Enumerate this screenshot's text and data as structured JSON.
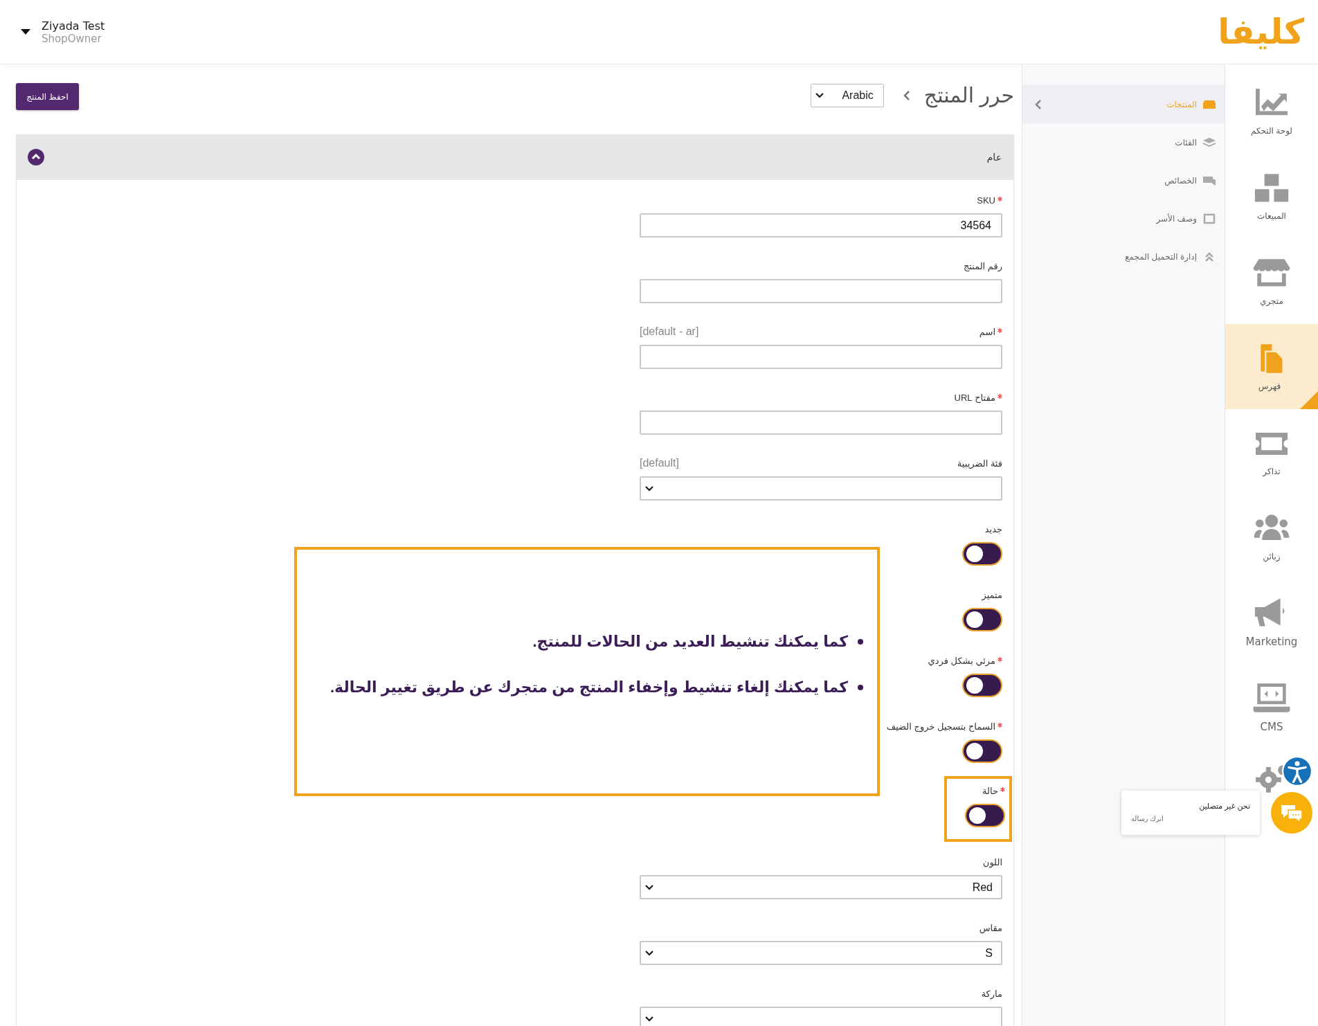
{
  "header": {
    "logo": "كليفا",
    "user_name": "Ziyada Test",
    "user_role": "ShopOwner"
  },
  "main_nav": [
    {
      "label": "لوحة التحكم",
      "selected": false
    },
    {
      "label": "المبيعات",
      "selected": false
    },
    {
      "label": "متجري",
      "selected": false
    },
    {
      "label": "فهرس",
      "selected": true
    },
    {
      "label": "تذاكر",
      "selected": false
    },
    {
      "label": "زبائن",
      "selected": false
    },
    {
      "label": "Marketing",
      "selected": false
    },
    {
      "label": "CMS",
      "selected": false
    }
  ],
  "sub_nav": [
    {
      "label": "المنتجات",
      "selected": true
    },
    {
      "label": "الفئات",
      "selected": false
    },
    {
      "label": "الخصائص",
      "selected": false
    },
    {
      "label": "وصف الأسر",
      "selected": false
    },
    {
      "label": "إدارة التحميل المجمع",
      "selected": false
    }
  ],
  "page": {
    "title": "حرر المنتج",
    "language": "Arabic",
    "save_button": "احفظ المنتج",
    "section_title": "عام",
    "section_expanded": true
  },
  "fields": [
    {
      "kind": "text",
      "label": "SKU",
      "required": true,
      "value": "34564"
    },
    {
      "kind": "text",
      "label": "رقم المنتج",
      "required": false
    },
    {
      "kind": "text",
      "label": "اسم",
      "required": true,
      "hint": "[default - ar]"
    },
    {
      "kind": "text",
      "label": "مفتاح URL",
      "required": true
    },
    {
      "kind": "select",
      "label": "فئة الضريبية",
      "required": false,
      "hint": "[default]"
    },
    {
      "kind": "toggle",
      "label": "جديد",
      "required": false,
      "on": false,
      "highlighted": false
    },
    {
      "kind": "toggle",
      "label": "متميز",
      "required": false,
      "on": false,
      "highlighted": false
    },
    {
      "kind": "toggle",
      "label": "مرئي بشكل فردي",
      "required": true,
      "on": false,
      "highlighted": false
    },
    {
      "kind": "toggle",
      "label": "السماح بتسجيل خروج الضيف",
      "required": true,
      "on": false,
      "highlighted": false
    },
    {
      "kind": "toggle",
      "label": "حالة",
      "required": true,
      "on": false,
      "highlighted": true
    },
    {
      "kind": "select",
      "label": "اللون",
      "required": false,
      "value": "Red"
    },
    {
      "kind": "select",
      "label": "مقاس",
      "required": false,
      "value": "S"
    },
    {
      "kind": "select",
      "label": "ماركة",
      "required": false
    }
  ],
  "annotation": [
    "كما يمكنك تنشيط العديد من الحالات للمنتج.",
    "كما يمكنك إلغاء تنشيط وإخفاء المنتج من متجرك عن طريق تغيير الحالة."
  ],
  "chat": {
    "title": "نحن غير متصلين",
    "subtitle": "اترك رسالة"
  }
}
